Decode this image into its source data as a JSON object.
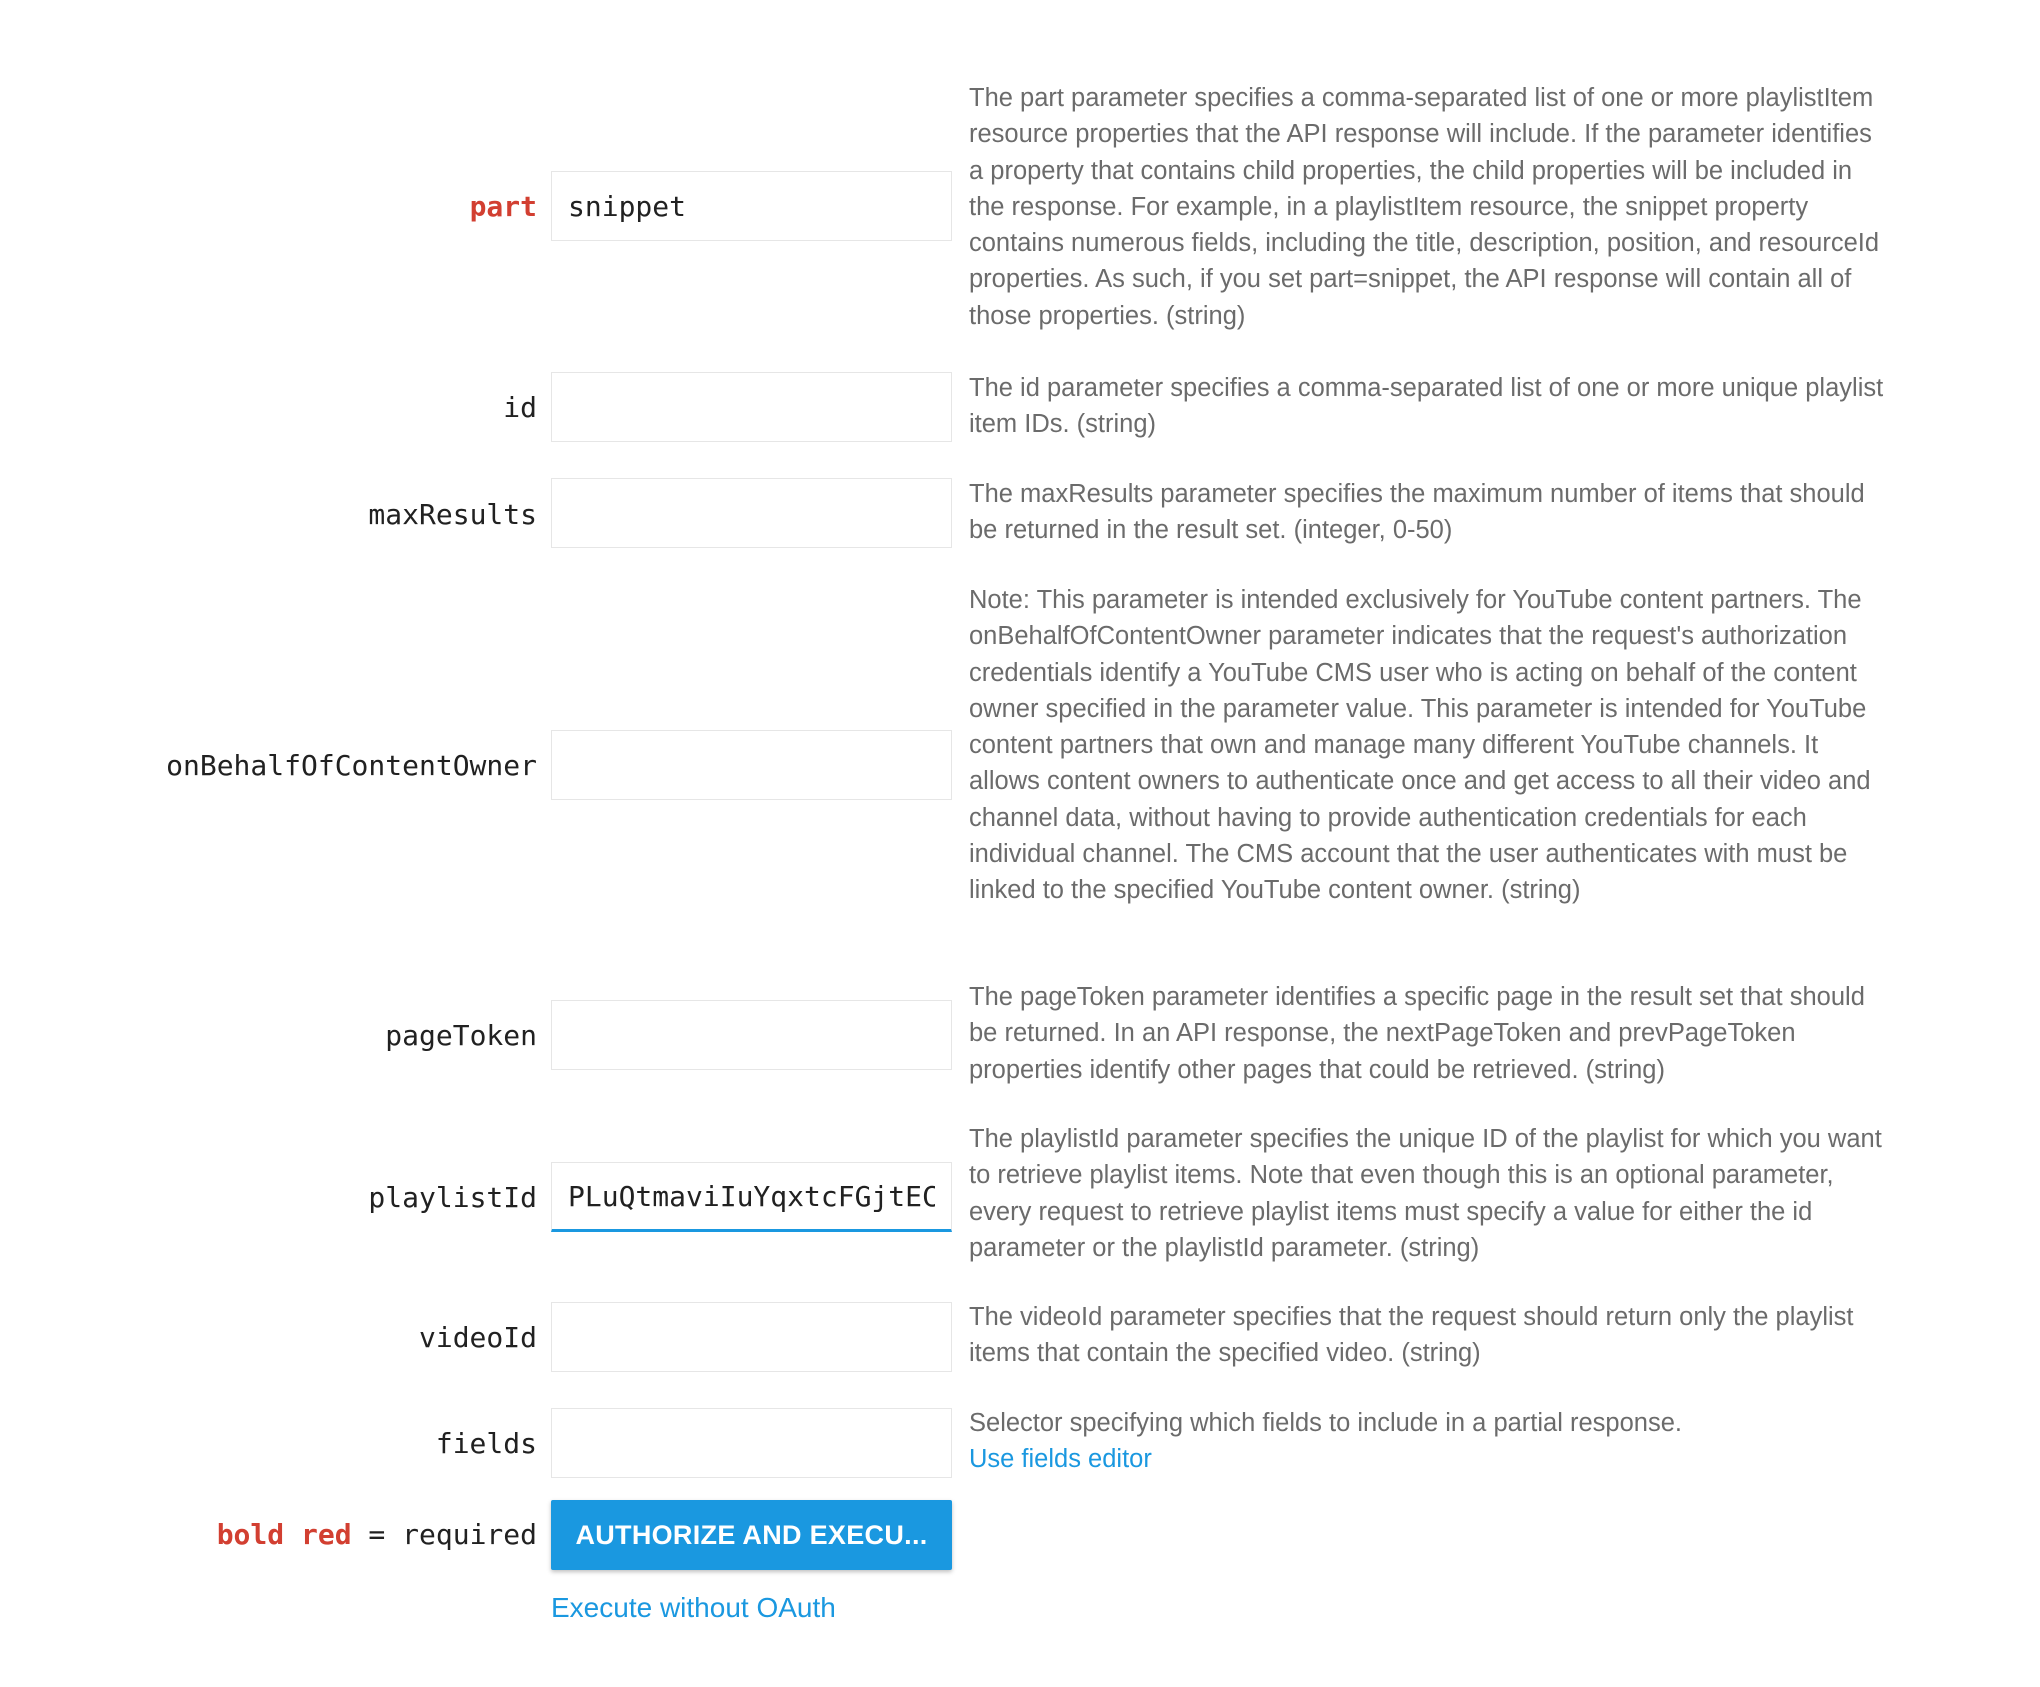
{
  "params": {
    "part": {
      "label": "part",
      "value": "snippet",
      "description": "The part parameter specifies a comma-separated list of one or more playlistItem resource properties that the API response will include. If the parameter identifies a property that contains child properties, the child properties will be included in the response. For example, in a playlistItem resource, the snippet property contains numerous fields, including the title, description, position, and resourceId properties. As such, if you set part=snippet, the API response will contain all of those properties. (string)"
    },
    "id": {
      "label": "id",
      "value": "",
      "description": "The id parameter specifies a comma-separated list of one or more unique playlist item IDs. (string)"
    },
    "maxResults": {
      "label": "maxResults",
      "value": "",
      "description": "The maxResults parameter specifies the maximum number of items that should be returned in the result set. (integer, 0-50)"
    },
    "onBehalfOfContentOwner": {
      "label": "onBehalfOfContentOwner",
      "value": "",
      "description": "Note: This parameter is intended exclusively for YouTube content partners. The onBehalfOfContentOwner parameter indicates that the request's authorization credentials identify a YouTube CMS user who is acting on behalf of the content owner specified in the parameter value. This parameter is intended for YouTube content partners that own and manage many different YouTube channels. It allows content owners to authenticate once and get access to all their video and channel data, without having to provide authentication credentials for each individual channel. The CMS account that the user authenticates with must be linked to the specified YouTube content owner. (string)"
    },
    "pageToken": {
      "label": "pageToken",
      "value": "",
      "description": "The pageToken parameter identifies a specific page in the result set that should be returned. In an API response, the nextPageToken and prevPageToken properties identify other pages that could be retrieved. (string)"
    },
    "playlistId": {
      "label": "playlistId",
      "value": "PLuQtmaviIuYqxtcFGjtEC",
      "description": "The playlistId parameter specifies the unique ID of the playlist for which you want to retrieve playlist items. Note that even though this is an optional parameter, every request to retrieve playlist items must specify a value for either the id parameter or the playlistId parameter. (string)"
    },
    "videoId": {
      "label": "videoId",
      "value": "",
      "description": "The videoId parameter specifies that the request should return only the playlist items that contain the specified video. (string)"
    },
    "fields": {
      "label": "fields",
      "value": "",
      "description": "Selector specifying which fields to include in a partial response.",
      "link": "Use fields editor"
    }
  },
  "legend": {
    "bold_red": "bold red",
    "rest": " = required"
  },
  "actions": {
    "authorize_label": "AUTHORIZE AND EXECU...",
    "execute_without_oauth": "Execute without OAuth"
  },
  "colors": {
    "accent": "#1a98e0",
    "required": "#d23f31",
    "description_text": "#6b6b6b",
    "label_text": "#212121"
  }
}
